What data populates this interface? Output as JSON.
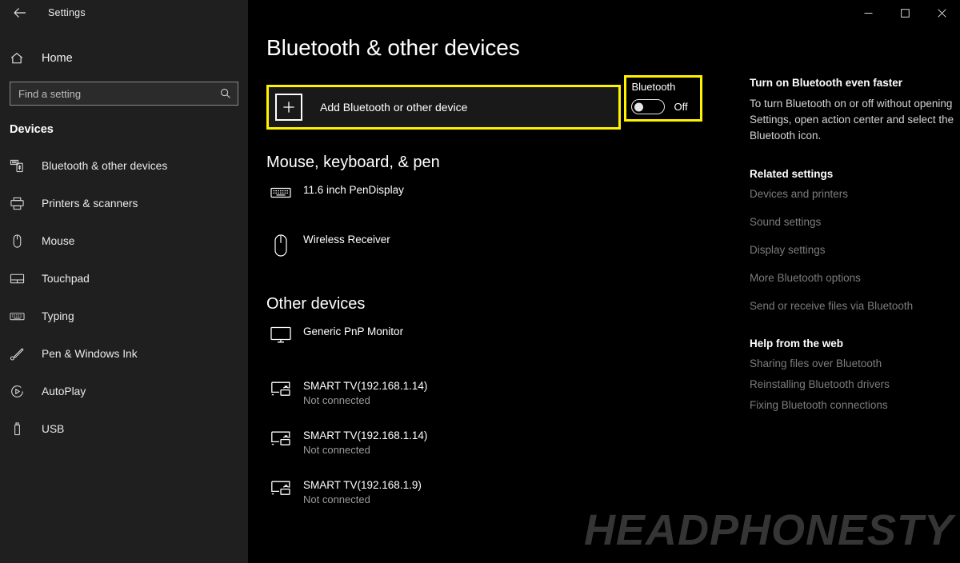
{
  "window": {
    "title": "Settings",
    "back_icon": "back-arrow-icon",
    "minimize_label": "–",
    "maximize_label": "□",
    "close_label": "✕"
  },
  "sidebar": {
    "home_label": "Home",
    "home_icon": "home-icon",
    "search": {
      "placeholder": "Find a setting",
      "value": "",
      "icon": "search-icon"
    },
    "section_label": "Devices",
    "items": [
      {
        "label": "Bluetooth & other devices",
        "icon": "bluetooth-devices-icon",
        "selected": true
      },
      {
        "label": "Printers & scanners",
        "icon": "printer-icon",
        "selected": false
      },
      {
        "label": "Mouse",
        "icon": "mouse-icon",
        "selected": false
      },
      {
        "label": "Touchpad",
        "icon": "touchpad-icon",
        "selected": false
      },
      {
        "label": "Typing",
        "icon": "keyboard-icon",
        "selected": false
      },
      {
        "label": "Pen & Windows Ink",
        "icon": "pen-icon",
        "selected": false
      },
      {
        "label": "AutoPlay",
        "icon": "autoplay-icon",
        "selected": false
      },
      {
        "label": "USB",
        "icon": "usb-icon",
        "selected": false
      }
    ]
  },
  "main": {
    "page_title": "Bluetooth & other devices",
    "add_device": {
      "label": "Add Bluetooth or other device",
      "icon": "plus-icon",
      "highlighted": true,
      "highlight_color": "#fff200"
    },
    "bluetooth_toggle": {
      "label": "Bluetooth",
      "state": "Off",
      "on": false,
      "highlighted": true,
      "highlight_color": "#fff200"
    },
    "groups": [
      {
        "title": "Mouse, keyboard, & pen",
        "devices": [
          {
            "name": "11.6 inch PenDisplay",
            "status": "",
            "icon": "keyboard-icon"
          },
          {
            "name": "Wireless Receiver",
            "status": "",
            "icon": "mouse-icon"
          }
        ]
      },
      {
        "title": "Other devices",
        "devices": [
          {
            "name": "Generic PnP Monitor",
            "status": "",
            "icon": "monitor-icon"
          },
          {
            "name": "SMART TV(192.168.1.14)",
            "status": "Not connected",
            "icon": "cast-display-icon"
          },
          {
            "name": "SMART TV(192.168.1.14)",
            "status": "Not connected",
            "icon": "cast-display-icon"
          },
          {
            "name": "SMART TV(192.168.1.9)",
            "status": "Not connected",
            "icon": "cast-display-icon"
          }
        ]
      }
    ]
  },
  "rail": {
    "tip": {
      "heading": "Turn on Bluetooth even faster",
      "body": "To turn Bluetooth on or off without opening Settings, open action center and select the Bluetooth icon."
    },
    "related": {
      "heading": "Related settings",
      "links": [
        "Devices and printers",
        "Sound settings",
        "Display settings",
        "More Bluetooth options",
        "Send or receive files via Bluetooth"
      ]
    },
    "help": {
      "heading": "Help from the web",
      "links": [
        "Sharing files over Bluetooth",
        "Reinstalling Bluetooth drivers",
        "Fixing Bluetooth connections"
      ]
    }
  },
  "watermark": {
    "text": "HEADPHONESTY",
    "color": "#353535"
  }
}
